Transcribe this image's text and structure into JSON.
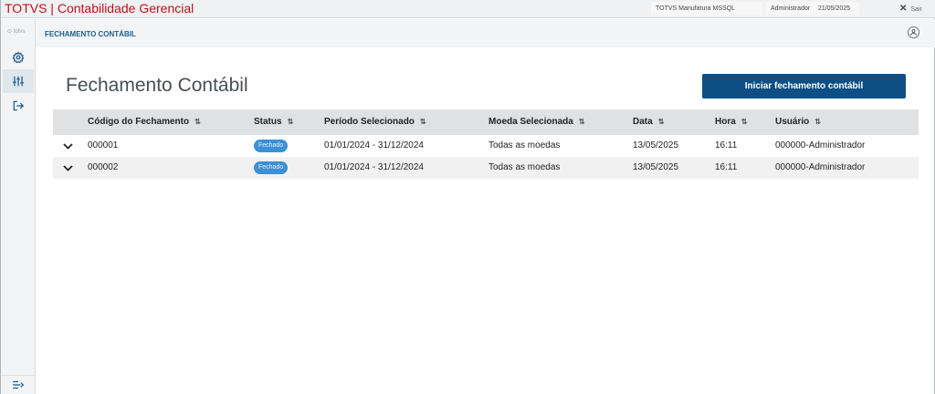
{
  "window": {
    "title": "TOTVS | Contabilidade Gerencial",
    "environment": "TOTVS Manufatura MSSQL",
    "user": "Administrador",
    "date": "21/05/2025",
    "exit_label": "Sair"
  },
  "sidebar": {
    "logo_text": "totvs",
    "items": [
      {
        "icon": "gear-icon"
      },
      {
        "icon": "sliders-icon"
      },
      {
        "icon": "logout-icon"
      }
    ],
    "bottom_icon": "expand-menu-icon"
  },
  "header": {
    "breadcrumb": "FECHAMENTO CONTÁBIL",
    "avatar_icon": "user-icon"
  },
  "page": {
    "title": "Fechamento Contábil",
    "primary_button": "Iniciar fechamento contábil"
  },
  "table": {
    "columns": [
      "Código do Fechamento",
      "Status",
      "Período Selecionado",
      "Moeda Selecionada",
      "Data",
      "Hora",
      "Usuário"
    ],
    "sort_glyph": "⇅",
    "rows": [
      {
        "codigo": "000001",
        "status": "Fechado",
        "periodo": "01/01/2024 - 31/12/2024",
        "moeda": "Todas as moedas",
        "data": "13/05/2025",
        "hora": "16:11",
        "usuario": "000000-Administrador"
      },
      {
        "codigo": "000002",
        "status": "Fechado",
        "periodo": "01/01/2024 - 31/12/2024",
        "moeda": "Todas as moedas",
        "data": "13/05/2025",
        "hora": "16:11",
        "usuario": "000000-Administrador"
      }
    ]
  },
  "colors": {
    "title_red": "#c0101e",
    "primary_blue": "#0d4f84",
    "badge_blue": "#3b90d6",
    "breadcrumb_blue": "#1b5f8e"
  }
}
